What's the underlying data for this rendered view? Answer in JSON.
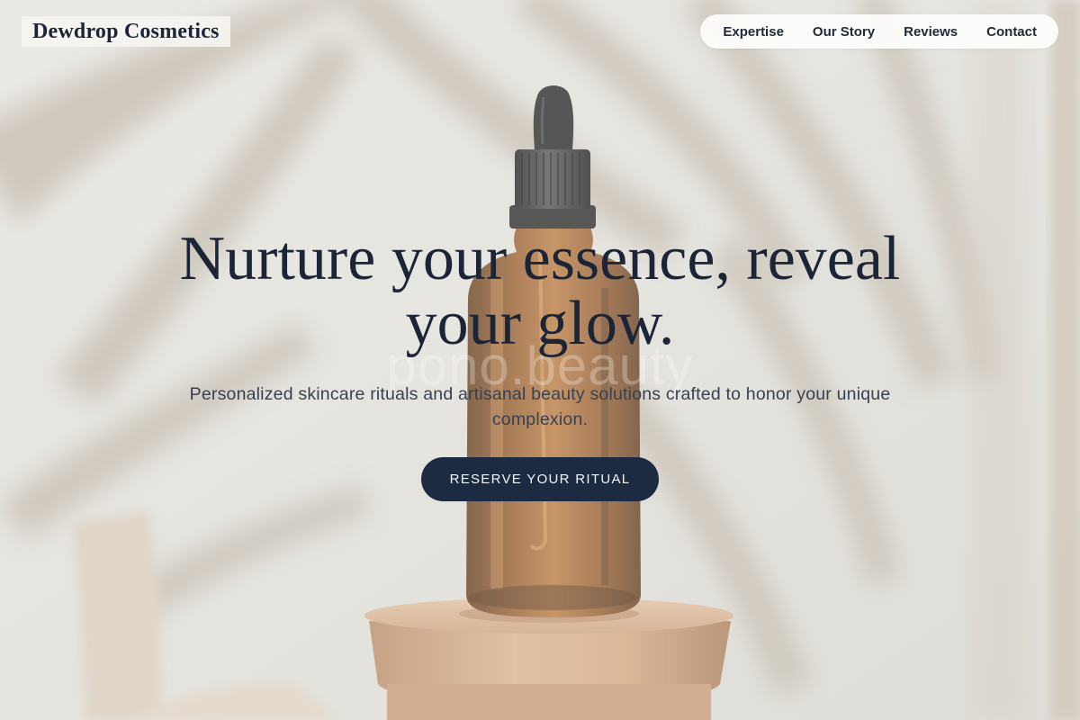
{
  "header": {
    "brand": "Dewdrop Cosmetics",
    "nav": [
      {
        "label": "Expertise"
      },
      {
        "label": "Our Story"
      },
      {
        "label": "Reviews"
      },
      {
        "label": "Contact"
      }
    ]
  },
  "hero": {
    "title": "Nurture your essence, reveal your glow.",
    "subtitle": "Personalized skincare rituals and artisanal beauty solutions crafted to honor your unique complexion.",
    "cta_label": "RESERVE YOUR RITUAL",
    "watermark": "pono.beauty"
  },
  "colors": {
    "brand_navy": "#1c2a42",
    "heading_text": "#1c2538",
    "body_text": "#374151",
    "amber_bottle": "#8a4f1f",
    "wall": "#e6e4df",
    "shadow": "#bdb2a5",
    "wood": "#d3a57f"
  }
}
